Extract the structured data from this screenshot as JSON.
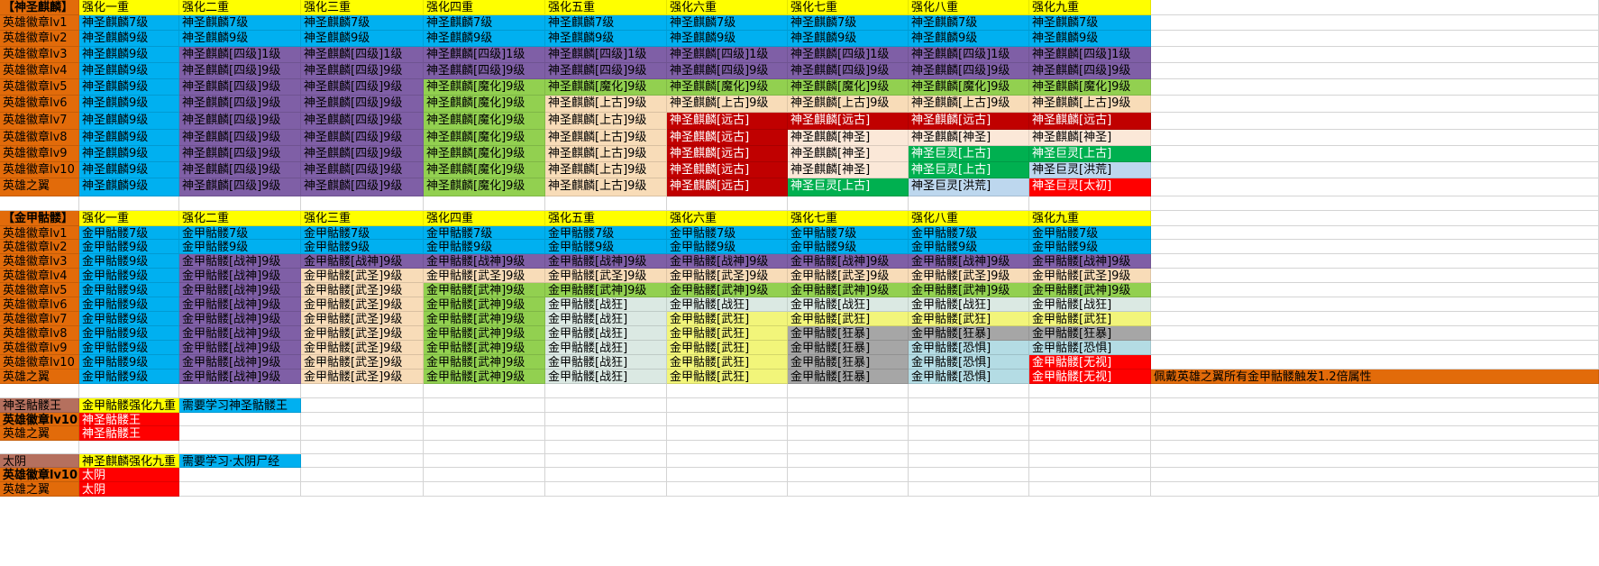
{
  "palette": {
    "blank": "#ffffff",
    "yellow": "#ffff00",
    "cyan": "#00b0f0",
    "purple": "#7f5fa6",
    "lime": "#92d050",
    "tan": "#f8dcb8",
    "red": "#c00000",
    "bright_red": "#ff0000",
    "green": "#00b050",
    "light_blue": "#bdd7ee",
    "pale": "#fbe8d8",
    "pale_green": "#dbe9e3",
    "pale_yellow": "#f2f57a",
    "gray": "#a6a6a6",
    "powder": "#b4dce4",
    "orange": "#e26b0a",
    "brown": "#b5705e"
  },
  "rows": [
    [
      [
        "【神圣麒麟】",
        "orange"
      ],
      [
        "强化一重",
        "yellow"
      ],
      [
        "强化二重",
        "yellow"
      ],
      [
        "强化三重",
        "yellow"
      ],
      [
        "强化四重",
        "yellow"
      ],
      [
        "强化五重",
        "yellow"
      ],
      [
        "强化六重",
        "yellow"
      ],
      [
        "强化七重",
        "yellow"
      ],
      [
        "强化八重",
        "yellow"
      ],
      [
        "强化九重",
        "yellow"
      ],
      [
        "",
        ""
      ]
    ],
    [
      [
        "英雄徽章lv1",
        "orange"
      ],
      [
        "神圣麒麟7级",
        "cyan"
      ],
      [
        "神圣麒麟7级",
        "cyan"
      ],
      [
        "神圣麒麟7级",
        "cyan"
      ],
      [
        "神圣麒麟7级",
        "cyan"
      ],
      [
        "神圣麒麟7级",
        "cyan"
      ],
      [
        "神圣麒麟7级",
        "cyan"
      ],
      [
        "神圣麒麟7级",
        "cyan"
      ],
      [
        "神圣麒麟7级",
        "cyan"
      ],
      [
        "神圣麒麟7级",
        "cyan"
      ],
      [
        "",
        ""
      ]
    ],
    [
      [
        "英雄徽章lv2",
        "orange"
      ],
      [
        "神圣麒麟9级",
        "cyan"
      ],
      [
        "神圣麒麟9级",
        "cyan"
      ],
      [
        "神圣麒麟9级",
        "cyan"
      ],
      [
        "神圣麒麟9级",
        "cyan"
      ],
      [
        "神圣麒麟9级",
        "cyan"
      ],
      [
        "神圣麒麟9级",
        "cyan"
      ],
      [
        "神圣麒麟9级",
        "cyan"
      ],
      [
        "神圣麒麟9级",
        "cyan"
      ],
      [
        "神圣麒麟9级",
        "cyan"
      ],
      [
        "",
        ""
      ]
    ],
    [
      [
        "英雄徽章lv3",
        "orange"
      ],
      [
        "神圣麒麟9级",
        "cyan"
      ],
      [
        "神圣麒麟[四级]1级",
        "purple"
      ],
      [
        "神圣麒麟[四级]1级",
        "purple"
      ],
      [
        "神圣麒麟[四级]1级",
        "purple"
      ],
      [
        "神圣麒麟[四级]1级",
        "purple"
      ],
      [
        "神圣麒麟[四级]1级",
        "purple"
      ],
      [
        "神圣麒麟[四级]1级",
        "purple"
      ],
      [
        "神圣麒麟[四级]1级",
        "purple"
      ],
      [
        "神圣麒麟[四级]1级",
        "purple"
      ],
      [
        "",
        ""
      ]
    ],
    [
      [
        "英雄徽章lv4",
        "orange"
      ],
      [
        "神圣麒麟9级",
        "cyan"
      ],
      [
        "神圣麒麟[四级]9级",
        "purple"
      ],
      [
        "神圣麒麟[四级]9级",
        "purple"
      ],
      [
        "神圣麒麟[四级]9级",
        "purple"
      ],
      [
        "神圣麒麟[四级]9级",
        "purple"
      ],
      [
        "神圣麒麟[四级]9级",
        "purple"
      ],
      [
        "神圣麒麟[四级]9级",
        "purple"
      ],
      [
        "神圣麒麟[四级]9级",
        "purple"
      ],
      [
        "神圣麒麟[四级]9级",
        "purple"
      ],
      [
        "",
        ""
      ]
    ],
    [
      [
        "英雄徽章lv5",
        "orange"
      ],
      [
        "神圣麒麟9级",
        "cyan"
      ],
      [
        "神圣麒麟[四级]9级",
        "purple"
      ],
      [
        "神圣麒麟[四级]9级",
        "purple"
      ],
      [
        "神圣麒麟[魔化]9级",
        "lime"
      ],
      [
        "神圣麒麟[魔化]9级",
        "lime"
      ],
      [
        "神圣麒麟[魔化]9级",
        "lime"
      ],
      [
        "神圣麒麟[魔化]9级",
        "lime"
      ],
      [
        "神圣麒麟[魔化]9级",
        "lime"
      ],
      [
        "神圣麒麟[魔化]9级",
        "lime"
      ],
      [
        "",
        ""
      ]
    ],
    [
      [
        "英雄徽章lv6",
        "orange"
      ],
      [
        "神圣麒麟9级",
        "cyan"
      ],
      [
        "神圣麒麟[四级]9级",
        "purple"
      ],
      [
        "神圣麒麟[四级]9级",
        "purple"
      ],
      [
        "神圣麒麟[魔化]9级",
        "lime"
      ],
      [
        "神圣麒麟[上古]9级",
        "tan"
      ],
      [
        "神圣麒麟[上古]9级",
        "tan"
      ],
      [
        "神圣麒麟[上古]9级",
        "tan"
      ],
      [
        "神圣麒麟[上古]9级",
        "tan"
      ],
      [
        "神圣麒麟[上古]9级",
        "tan"
      ],
      [
        "",
        ""
      ]
    ],
    [
      [
        "英雄徽章lv7",
        "orange"
      ],
      [
        "神圣麒麟9级",
        "cyan"
      ],
      [
        "神圣麒麟[四级]9级",
        "purple"
      ],
      [
        "神圣麒麟[四级]9级",
        "purple"
      ],
      [
        "神圣麒麟[魔化]9级",
        "lime"
      ],
      [
        "神圣麒麟[上古]9级",
        "tan"
      ],
      [
        "神圣麒麟[远古]",
        "red"
      ],
      [
        "神圣麒麟[远古]",
        "red"
      ],
      [
        "神圣麒麟[远古]",
        "red"
      ],
      [
        "神圣麒麟[远古]",
        "red"
      ],
      [
        "",
        ""
      ]
    ],
    [
      [
        "英雄徽章lv8",
        "orange"
      ],
      [
        "神圣麒麟9级",
        "cyan"
      ],
      [
        "神圣麒麟[四级]9级",
        "purple"
      ],
      [
        "神圣麒麟[四级]9级",
        "purple"
      ],
      [
        "神圣麒麟[魔化]9级",
        "lime"
      ],
      [
        "神圣麒麟[上古]9级",
        "tan"
      ],
      [
        "神圣麒麟[远古]",
        "red"
      ],
      [
        "神圣麒麟[神圣]",
        "pale"
      ],
      [
        "神圣麒麟[神圣]",
        "pale"
      ],
      [
        "神圣麒麟[神圣]",
        "pale"
      ],
      [
        "",
        ""
      ]
    ],
    [
      [
        "英雄徽章lv9",
        "orange"
      ],
      [
        "神圣麒麟9级",
        "cyan"
      ],
      [
        "神圣麒麟[四级]9级",
        "purple"
      ],
      [
        "神圣麒麟[四级]9级",
        "purple"
      ],
      [
        "神圣麒麟[魔化]9级",
        "lime"
      ],
      [
        "神圣麒麟[上古]9级",
        "tan"
      ],
      [
        "神圣麒麟[远古]",
        "red"
      ],
      [
        "神圣麒麟[神圣]",
        "pale"
      ],
      [
        "神圣巨灵[上古]",
        "green"
      ],
      [
        "神圣巨灵[上古]",
        "green"
      ],
      [
        "",
        ""
      ]
    ],
    [
      [
        "英雄徽章lv10",
        "orange"
      ],
      [
        "神圣麒麟9级",
        "cyan"
      ],
      [
        "神圣麒麟[四级]9级",
        "purple"
      ],
      [
        "神圣麒麟[四级]9级",
        "purple"
      ],
      [
        "神圣麒麟[魔化]9级",
        "lime"
      ],
      [
        "神圣麒麟[上古]9级",
        "tan"
      ],
      [
        "神圣麒麟[远古]",
        "red"
      ],
      [
        "神圣麒麟[神圣]",
        "pale"
      ],
      [
        "神圣巨灵[上古]",
        "green"
      ],
      [
        "神圣巨灵[洪荒]",
        "light_blue"
      ],
      [
        "",
        ""
      ]
    ],
    [
      [
        "英雄之翼",
        "orange"
      ],
      [
        "神圣麒麟9级",
        "cyan"
      ],
      [
        "神圣麒麟[四级]9级",
        "purple"
      ],
      [
        "神圣麒麟[四级]9级",
        "purple"
      ],
      [
        "神圣麒麟[魔化]9级",
        "lime"
      ],
      [
        "神圣麒麟[上古]9级",
        "tan"
      ],
      [
        "神圣麒麟[远古]",
        "red"
      ],
      [
        "神圣巨灵[上古]",
        "green"
      ],
      [
        "神圣巨灵[洪荒]",
        "light_blue"
      ],
      [
        "神圣巨灵[太初]",
        "bright_red"
      ],
      [
        "",
        ""
      ]
    ],
    [
      [
        "",
        ""
      ],
      [
        "",
        ""
      ],
      [
        "",
        ""
      ],
      [
        "",
        ""
      ],
      [
        "",
        ""
      ],
      [
        "",
        ""
      ],
      [
        "",
        ""
      ],
      [
        "",
        ""
      ],
      [
        "",
        ""
      ],
      [
        "",
        ""
      ],
      [
        "",
        ""
      ]
    ],
    [
      [
        "【金甲骷髅】",
        "orange"
      ],
      [
        "强化一重",
        "yellow"
      ],
      [
        "强化二重",
        "yellow"
      ],
      [
        "强化三重",
        "yellow"
      ],
      [
        "强化四重",
        "yellow"
      ],
      [
        "强化五重",
        "yellow"
      ],
      [
        "强化六重",
        "yellow"
      ],
      [
        "强化七重",
        "yellow"
      ],
      [
        "强化八重",
        "yellow"
      ],
      [
        "强化九重",
        "yellow"
      ],
      [
        "",
        ""
      ]
    ],
    [
      [
        "英雄徽章lv1",
        "orange"
      ],
      [
        "金甲骷髅7级",
        "cyan"
      ],
      [
        "金甲骷髅7级",
        "cyan"
      ],
      [
        "金甲骷髅7级",
        "cyan"
      ],
      [
        "金甲骷髅7级",
        "cyan"
      ],
      [
        "金甲骷髅7级",
        "cyan"
      ],
      [
        "金甲骷髅7级",
        "cyan"
      ],
      [
        "金甲骷髅7级",
        "cyan"
      ],
      [
        "金甲骷髅7级",
        "cyan"
      ],
      [
        "金甲骷髅7级",
        "cyan"
      ],
      [
        "",
        ""
      ]
    ],
    [
      [
        "英雄徽章lv2",
        "orange"
      ],
      [
        "金甲骷髅9级",
        "cyan"
      ],
      [
        "金甲骷髅9级",
        "cyan"
      ],
      [
        "金甲骷髅9级",
        "cyan"
      ],
      [
        "金甲骷髅9级",
        "cyan"
      ],
      [
        "金甲骷髅9级",
        "cyan"
      ],
      [
        "金甲骷髅9级",
        "cyan"
      ],
      [
        "金甲骷髅9级",
        "cyan"
      ],
      [
        "金甲骷髅9级",
        "cyan"
      ],
      [
        "金甲骷髅9级",
        "cyan"
      ],
      [
        "",
        ""
      ]
    ],
    [
      [
        "英雄徽章lv3",
        "orange"
      ],
      [
        "金甲骷髅9级",
        "cyan"
      ],
      [
        "金甲骷髅[战神]9级",
        "purple"
      ],
      [
        "金甲骷髅[战神]9级",
        "purple"
      ],
      [
        "金甲骷髅[战神]9级",
        "purple"
      ],
      [
        "金甲骷髅[战神]9级",
        "purple"
      ],
      [
        "金甲骷髅[战神]9级",
        "purple"
      ],
      [
        "金甲骷髅[战神]9级",
        "purple"
      ],
      [
        "金甲骷髅[战神]9级",
        "purple"
      ],
      [
        "金甲骷髅[战神]9级",
        "purple"
      ],
      [
        "",
        ""
      ]
    ],
    [
      [
        "英雄徽章lv4",
        "orange"
      ],
      [
        "金甲骷髅9级",
        "cyan"
      ],
      [
        "金甲骷髅[战神]9级",
        "purple"
      ],
      [
        "金甲骷髅[武圣]9级",
        "tan"
      ],
      [
        "金甲骷髅[武圣]9级",
        "tan"
      ],
      [
        "金甲骷髅[武圣]9级",
        "tan"
      ],
      [
        "金甲骷髅[武圣]9级",
        "tan"
      ],
      [
        "金甲骷髅[武圣]9级",
        "tan"
      ],
      [
        "金甲骷髅[武圣]9级",
        "tan"
      ],
      [
        "金甲骷髅[武圣]9级",
        "tan"
      ],
      [
        "",
        ""
      ]
    ],
    [
      [
        "英雄徽章lv5",
        "orange"
      ],
      [
        "金甲骷髅9级",
        "cyan"
      ],
      [
        "金甲骷髅[战神]9级",
        "purple"
      ],
      [
        "金甲骷髅[武圣]9级",
        "tan"
      ],
      [
        "金甲骷髅[武神]9级",
        "lime"
      ],
      [
        "金甲骷髅[武神]9级",
        "lime"
      ],
      [
        "金甲骷髅[武神]9级",
        "lime"
      ],
      [
        "金甲骷髅[武神]9级",
        "lime"
      ],
      [
        "金甲骷髅[武神]9级",
        "lime"
      ],
      [
        "金甲骷髅[武神]9级",
        "lime"
      ],
      [
        "",
        ""
      ]
    ],
    [
      [
        "英雄徽章lv6",
        "orange"
      ],
      [
        "金甲骷髅9级",
        "cyan"
      ],
      [
        "金甲骷髅[战神]9级",
        "purple"
      ],
      [
        "金甲骷髅[武圣]9级",
        "tan"
      ],
      [
        "金甲骷髅[武神]9级",
        "lime"
      ],
      [
        "金甲骷髅[战狂]",
        "pale_green"
      ],
      [
        "金甲骷髅[战狂]",
        "pale_green"
      ],
      [
        "金甲骷髅[战狂]",
        "pale_green"
      ],
      [
        "金甲骷髅[战狂]",
        "pale_green"
      ],
      [
        "金甲骷髅[战狂]",
        "pale_green"
      ],
      [
        "",
        ""
      ]
    ],
    [
      [
        "英雄徽章lv7",
        "orange"
      ],
      [
        "金甲骷髅9级",
        "cyan"
      ],
      [
        "金甲骷髅[战神]9级",
        "purple"
      ],
      [
        "金甲骷髅[武圣]9级",
        "tan"
      ],
      [
        "金甲骷髅[武神]9级",
        "lime"
      ],
      [
        "金甲骷髅[战狂]",
        "pale_green"
      ],
      [
        "金甲骷髅[武狂]",
        "pale_yellow"
      ],
      [
        "金甲骷髅[武狂]",
        "pale_yellow"
      ],
      [
        "金甲骷髅[武狂]",
        "pale_yellow"
      ],
      [
        "金甲骷髅[武狂]",
        "pale_yellow"
      ],
      [
        "",
        ""
      ]
    ],
    [
      [
        "英雄徽章lv8",
        "orange"
      ],
      [
        "金甲骷髅9级",
        "cyan"
      ],
      [
        "金甲骷髅[战神]9级",
        "purple"
      ],
      [
        "金甲骷髅[武圣]9级",
        "tan"
      ],
      [
        "金甲骷髅[武神]9级",
        "lime"
      ],
      [
        "金甲骷髅[战狂]",
        "pale_green"
      ],
      [
        "金甲骷髅[武狂]",
        "pale_yellow"
      ],
      [
        "金甲骷髅[狂暴]",
        "gray"
      ],
      [
        "金甲骷髅[狂暴]",
        "gray"
      ],
      [
        "金甲骷髅[狂暴]",
        "gray"
      ],
      [
        "",
        ""
      ]
    ],
    [
      [
        "英雄徽章lv9",
        "orange"
      ],
      [
        "金甲骷髅9级",
        "cyan"
      ],
      [
        "金甲骷髅[战神]9级",
        "purple"
      ],
      [
        "金甲骷髅[武圣]9级",
        "tan"
      ],
      [
        "金甲骷髅[武神]9级",
        "lime"
      ],
      [
        "金甲骷髅[战狂]",
        "pale_green"
      ],
      [
        "金甲骷髅[武狂]",
        "pale_yellow"
      ],
      [
        "金甲骷髅[狂暴]",
        "gray"
      ],
      [
        "金甲骷髅[恐惧]",
        "powder"
      ],
      [
        "金甲骷髅[恐惧]",
        "powder"
      ],
      [
        "",
        ""
      ]
    ],
    [
      [
        "英雄徽章lv10",
        "orange"
      ],
      [
        "金甲骷髅9级",
        "cyan"
      ],
      [
        "金甲骷髅[战神]9级",
        "purple"
      ],
      [
        "金甲骷髅[武圣]9级",
        "tan"
      ],
      [
        "金甲骷髅[武神]9级",
        "lime"
      ],
      [
        "金甲骷髅[战狂]",
        "pale_green"
      ],
      [
        "金甲骷髅[武狂]",
        "pale_yellow"
      ],
      [
        "金甲骷髅[狂暴]",
        "gray"
      ],
      [
        "金甲骷髅[恐惧]",
        "powder"
      ],
      [
        "金甲骷髅[无视]",
        "bright_red"
      ],
      [
        "",
        ""
      ]
    ],
    [
      [
        "英雄之翼",
        "orange"
      ],
      [
        "金甲骷髅9级",
        "cyan"
      ],
      [
        "金甲骷髅[战神]9级",
        "purple"
      ],
      [
        "金甲骷髅[武圣]9级",
        "tan"
      ],
      [
        "金甲骷髅[武神]9级",
        "lime"
      ],
      [
        "金甲骷髅[战狂]",
        "pale_green"
      ],
      [
        "金甲骷髅[武狂]",
        "pale_yellow"
      ],
      [
        "金甲骷髅[狂暴]",
        "gray"
      ],
      [
        "金甲骷髅[恐惧]",
        "powder"
      ],
      [
        "金甲骷髅[无视]",
        "bright_red"
      ],
      [
        "佩戴英雄之翼所有金甲骷髅触发1.2倍属性",
        "orange"
      ]
    ],
    [
      [
        "",
        ""
      ],
      [
        "",
        ""
      ],
      [
        "",
        ""
      ],
      [
        "",
        ""
      ],
      [
        "",
        ""
      ],
      [
        "",
        ""
      ],
      [
        "",
        ""
      ],
      [
        "",
        ""
      ],
      [
        "",
        ""
      ],
      [
        "",
        ""
      ],
      [
        "",
        ""
      ]
    ],
    [
      [
        "神圣骷髅王",
        "brown"
      ],
      [
        "金甲骷髅强化九重",
        "yellow"
      ],
      [
        "需要学习神圣骷髅王",
        "cyan"
      ],
      [
        "",
        ""
      ],
      [
        "",
        ""
      ],
      [
        "",
        ""
      ],
      [
        "",
        ""
      ],
      [
        "",
        ""
      ],
      [
        "",
        ""
      ],
      [
        "",
        ""
      ],
      [
        "",
        ""
      ]
    ],
    [
      [
        "英雄徽章lv10",
        "orange"
      ],
      [
        "神圣骷髅王",
        "bright_red"
      ],
      [
        "",
        ""
      ],
      [
        "",
        ""
      ],
      [
        "",
        ""
      ],
      [
        "",
        ""
      ],
      [
        "",
        ""
      ],
      [
        "",
        ""
      ],
      [
        "",
        ""
      ],
      [
        "",
        ""
      ],
      [
        "",
        ""
      ]
    ],
    [
      [
        "英雄之翼",
        "orange"
      ],
      [
        "神圣骷髅王",
        "bright_red"
      ],
      [
        "",
        ""
      ],
      [
        "",
        ""
      ],
      [
        "",
        ""
      ],
      [
        "",
        ""
      ],
      [
        "",
        ""
      ],
      [
        "",
        ""
      ],
      [
        "",
        ""
      ],
      [
        "",
        ""
      ],
      [
        "",
        ""
      ]
    ],
    [
      [
        "",
        ""
      ],
      [
        "",
        ""
      ],
      [
        "",
        ""
      ],
      [
        "",
        ""
      ],
      [
        "",
        ""
      ],
      [
        "",
        ""
      ],
      [
        "",
        ""
      ],
      [
        "",
        ""
      ],
      [
        "",
        ""
      ],
      [
        "",
        ""
      ],
      [
        "",
        ""
      ]
    ],
    [
      [
        "太阴",
        "brown"
      ],
      [
        "神圣麒麟强化九重",
        "yellow"
      ],
      [
        "需要学习·太阴尸经",
        "cyan"
      ],
      [
        "",
        ""
      ],
      [
        "",
        ""
      ],
      [
        "",
        ""
      ],
      [
        "",
        ""
      ],
      [
        "",
        ""
      ],
      [
        "",
        ""
      ],
      [
        "",
        ""
      ],
      [
        "",
        ""
      ]
    ],
    [
      [
        "英雄徽章lv10",
        "orange"
      ],
      [
        "太阴",
        "bright_red"
      ],
      [
        "",
        ""
      ],
      [
        "",
        ""
      ],
      [
        "",
        ""
      ],
      [
        "",
        ""
      ],
      [
        "",
        ""
      ],
      [
        "",
        ""
      ],
      [
        "",
        ""
      ],
      [
        "",
        ""
      ],
      [
        "",
        ""
      ]
    ],
    [
      [
        "英雄之翼",
        "orange"
      ],
      [
        "太阴",
        "bright_red"
      ],
      [
        "",
        ""
      ],
      [
        "",
        ""
      ],
      [
        "",
        ""
      ],
      [
        "",
        ""
      ],
      [
        "",
        ""
      ],
      [
        "",
        ""
      ],
      [
        "",
        ""
      ],
      [
        "",
        ""
      ],
      [
        "",
        ""
      ]
    ]
  ]
}
